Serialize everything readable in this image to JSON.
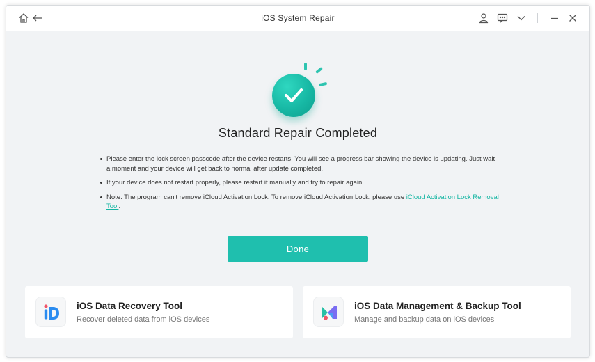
{
  "window": {
    "title": "iOS System Repair"
  },
  "result": {
    "headline": "Standard Repair Completed"
  },
  "notes": [
    {
      "text": "Please enter the lock screen passcode after the device restarts. You will see a progress bar showing the device is updating. Just wait a moment and your device will get back to normal after update completed."
    },
    {
      "text": "If your device does not restart properly, please restart it manually and try to repair again."
    },
    {
      "text": "Note: The program can't remove iCloud Activation Lock. To remove iCloud Activation Lock, please use ",
      "link": "iCloud Activation Lock Removal Tool",
      "suffix": "."
    }
  ],
  "actions": {
    "done_label": "Done"
  },
  "tools": [
    {
      "title": "iOS Data Recovery Tool",
      "subtitle": "Recover deleted data from iOS devices",
      "icon": "data-recovery-icon"
    },
    {
      "title": "iOS Data Management & Backup Tool",
      "subtitle": "Manage and backup data on iOS devices",
      "icon": "data-management-icon"
    }
  ],
  "colors": {
    "accent": "#1fbfae",
    "link": "#13b5a2",
    "background": "#f1f3f5"
  }
}
